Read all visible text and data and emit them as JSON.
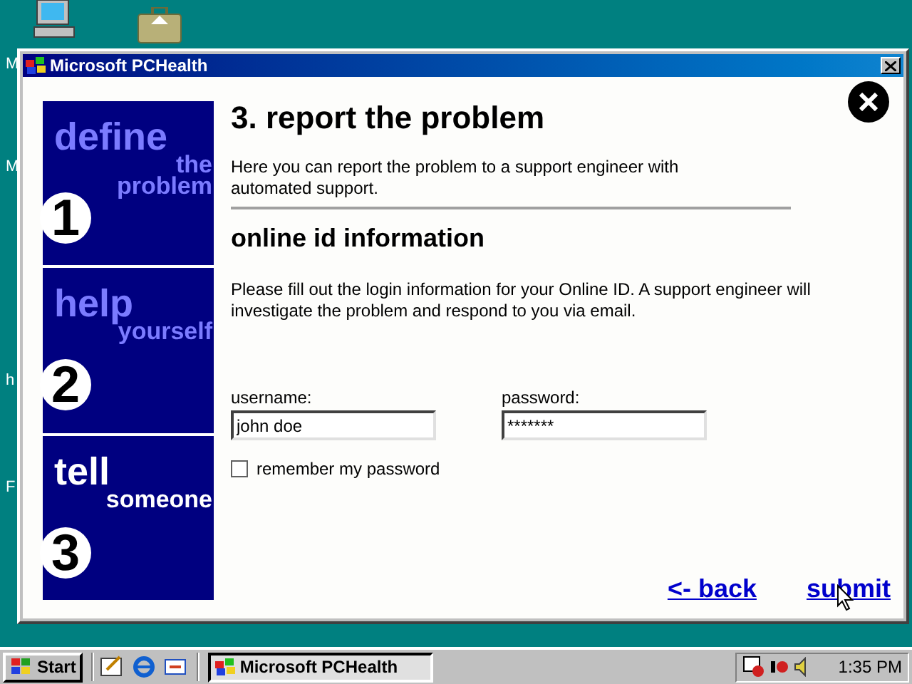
{
  "desktop": {
    "labels": [
      "M",
      "M",
      "h",
      "F"
    ]
  },
  "window": {
    "title": "Microsoft PCHealth"
  },
  "steps": [
    {
      "word": "define",
      "subword": "the problem",
      "number": "1",
      "selected": false
    },
    {
      "word": "help",
      "subword": "yourself",
      "number": "2",
      "selected": false
    },
    {
      "word": "tell",
      "subword": "someone",
      "number": "3",
      "selected": true
    }
  ],
  "heading": "3. report the problem",
  "intro": "Here you can report the problem to a support engineer with automated support.",
  "section_title": "online id information",
  "instructions": "Please fill out the login information for your Online ID. A support engineer will investigate the problem and respond to you via email.",
  "form": {
    "username": {
      "label": "username:",
      "value": "john doe"
    },
    "password": {
      "label": "password:",
      "value": "*******"
    },
    "remember": {
      "label": "remember my password",
      "checked": false
    }
  },
  "links": [
    "<- back",
    "submit"
  ],
  "taskbar": {
    "start": "Start",
    "task": "Microsoft PCHealth",
    "clock": "1:35 PM"
  }
}
